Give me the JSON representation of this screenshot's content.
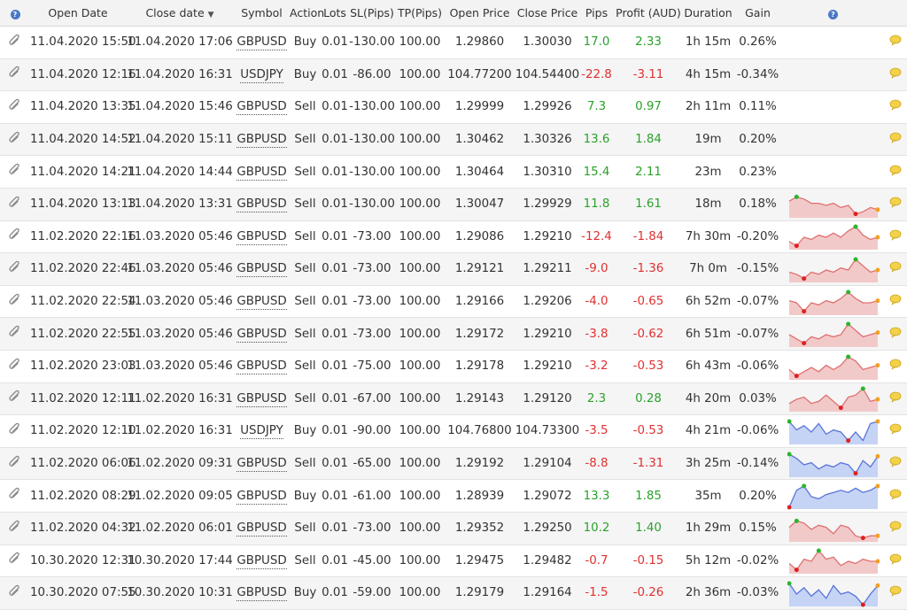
{
  "colors": {
    "positive": "#2aa12a",
    "negative": "#e03030",
    "spark_red_fill": "#f2c9c9",
    "spark_red_line": "#e07070",
    "spark_blue_fill": "#c5d4f5",
    "spark_blue_line": "#5a74d8"
  },
  "header": {
    "help_icon": "help-icon",
    "open_date": "Open Date",
    "close_date": "Close date",
    "symbol": "Symbol",
    "action": "Action",
    "lots": "Lots",
    "sl": "SL(Pips)",
    "tp": "TP(Pips)",
    "open_price": "Open Price",
    "close_price": "Close Price",
    "pips": "Pips",
    "profit": "Profit (AUD)",
    "duration": "Duration",
    "gain": "Gain"
  },
  "rows": [
    {
      "open_date": "11.04.2020 15:50",
      "close_date": "11.04.2020 17:06",
      "symbol": "GBPUSD",
      "action": "Buy",
      "lots": "0.01",
      "sl": "-130.00",
      "tp": "100.00",
      "open_price": "1.29860",
      "close_price": "1.30030",
      "pips": "17.0",
      "profit": "2.33",
      "duration": "1h 15m",
      "gain": "0.26%",
      "spark": null
    },
    {
      "open_date": "11.04.2020 12:16",
      "close_date": "11.04.2020 16:31",
      "symbol": "USDJPY",
      "action": "Buy",
      "lots": "0.01",
      "sl": "-86.00",
      "tp": "100.00",
      "open_price": "104.77200",
      "close_price": "104.54400",
      "pips": "-22.8",
      "profit": "-3.11",
      "duration": "4h 15m",
      "gain": "-0.34%",
      "spark": null
    },
    {
      "open_date": "11.04.2020 13:35",
      "close_date": "11.04.2020 15:46",
      "symbol": "GBPUSD",
      "action": "Sell",
      "lots": "0.01",
      "sl": "-130.00",
      "tp": "100.00",
      "open_price": "1.29999",
      "close_price": "1.29926",
      "pips": "7.3",
      "profit": "0.97",
      "duration": "2h 11m",
      "gain": "0.11%",
      "spark": null
    },
    {
      "open_date": "11.04.2020 14:52",
      "close_date": "11.04.2020 15:11",
      "symbol": "GBPUSD",
      "action": "Sell",
      "lots": "0.01",
      "sl": "-130.00",
      "tp": "100.00",
      "open_price": "1.30462",
      "close_price": "1.30326",
      "pips": "13.6",
      "profit": "1.84",
      "duration": "19m",
      "gain": "0.20%",
      "spark": null
    },
    {
      "open_date": "11.04.2020 14:21",
      "close_date": "11.04.2020 14:44",
      "symbol": "GBPUSD",
      "action": "Sell",
      "lots": "0.01",
      "sl": "-130.00",
      "tp": "100.00",
      "open_price": "1.30464",
      "close_price": "1.30310",
      "pips": "15.4",
      "profit": "2.11",
      "duration": "23m",
      "gain": "0.23%",
      "spark": null
    },
    {
      "open_date": "11.04.2020 13:13",
      "close_date": "11.04.2020 13:31",
      "symbol": "GBPUSD",
      "action": "Sell",
      "lots": "0.01",
      "sl": "-130.00",
      "tp": "100.00",
      "open_price": "1.30047",
      "close_price": "1.29929",
      "pips": "11.8",
      "profit": "1.61",
      "duration": "18m",
      "gain": "0.18%",
      "spark": {
        "color": "red",
        "values": [
          0.7,
          0.9,
          0.8,
          0.6,
          0.6,
          0.5,
          0.6,
          0.4,
          0.5,
          0.1,
          0.2,
          0.4,
          0.3
        ]
      }
    },
    {
      "open_date": "11.02.2020 22:16",
      "close_date": "11.03.2020 05:46",
      "symbol": "GBPUSD",
      "action": "Sell",
      "lots": "0.01",
      "sl": "-73.00",
      "tp": "100.00",
      "open_price": "1.29086",
      "close_price": "1.29210",
      "pips": "-12.4",
      "profit": "-1.84",
      "duration": "7h 30m",
      "gain": "-0.20%",
      "spark": {
        "color": "red",
        "values": [
          0.3,
          0.1,
          0.5,
          0.4,
          0.6,
          0.5,
          0.7,
          0.5,
          0.8,
          1.0,
          0.6,
          0.4,
          0.5
        ]
      }
    },
    {
      "open_date": "11.02.2020 22:46",
      "close_date": "11.03.2020 05:46",
      "symbol": "GBPUSD",
      "action": "Sell",
      "lots": "0.01",
      "sl": "-73.00",
      "tp": "100.00",
      "open_price": "1.29121",
      "close_price": "1.29211",
      "pips": "-9.0",
      "profit": "-1.36",
      "duration": "7h 0m",
      "gain": "-0.15%",
      "spark": {
        "color": "red",
        "values": [
          0.4,
          0.3,
          0.1,
          0.4,
          0.3,
          0.5,
          0.4,
          0.6,
          0.5,
          1.0,
          0.7,
          0.4,
          0.5
        ]
      }
    },
    {
      "open_date": "11.02.2020 22:54",
      "close_date": "11.03.2020 05:46",
      "symbol": "GBPUSD",
      "action": "Sell",
      "lots": "0.01",
      "sl": "-73.00",
      "tp": "100.00",
      "open_price": "1.29166",
      "close_price": "1.29206",
      "pips": "-4.0",
      "profit": "-0.65",
      "duration": "6h 52m",
      "gain": "-0.07%",
      "spark": {
        "color": "red",
        "values": [
          0.6,
          0.5,
          0.1,
          0.5,
          0.4,
          0.6,
          0.5,
          0.7,
          1.0,
          0.7,
          0.5,
          0.5,
          0.6
        ]
      }
    },
    {
      "open_date": "11.02.2020 22:55",
      "close_date": "11.03.2020 05:46",
      "symbol": "GBPUSD",
      "action": "Sell",
      "lots": "0.01",
      "sl": "-73.00",
      "tp": "100.00",
      "open_price": "1.29172",
      "close_price": "1.29210",
      "pips": "-3.8",
      "profit": "-0.62",
      "duration": "6h 51m",
      "gain": "-0.07%",
      "spark": {
        "color": "red",
        "values": [
          0.5,
          0.3,
          0.1,
          0.4,
          0.3,
          0.5,
          0.4,
          0.5,
          1.0,
          0.7,
          0.4,
          0.5,
          0.6
        ]
      }
    },
    {
      "open_date": "11.02.2020 23:03",
      "close_date": "11.03.2020 05:46",
      "symbol": "GBPUSD",
      "action": "Sell",
      "lots": "0.01",
      "sl": "-75.00",
      "tp": "100.00",
      "open_price": "1.29178",
      "close_price": "1.29210",
      "pips": "-3.2",
      "profit": "-0.53",
      "duration": "6h 43m",
      "gain": "-0.06%",
      "spark": {
        "color": "red",
        "values": [
          0.4,
          0.1,
          0.3,
          0.5,
          0.3,
          0.6,
          0.4,
          0.6,
          1.0,
          0.8,
          0.4,
          0.5,
          0.6
        ]
      }
    },
    {
      "open_date": "11.02.2020 12:11",
      "close_date": "11.02.2020 16:31",
      "symbol": "GBPUSD",
      "action": "Sell",
      "lots": "0.01",
      "sl": "-67.00",
      "tp": "100.00",
      "open_price": "1.29143",
      "close_price": "1.29120",
      "pips": "2.3",
      "profit": "0.28",
      "duration": "4h 20m",
      "gain": "0.03%",
      "spark": {
        "color": "red",
        "values": [
          0.3,
          0.5,
          0.6,
          0.3,
          0.4,
          0.7,
          0.4,
          0.1,
          0.6,
          0.7,
          1.0,
          0.4,
          0.5
        ]
      }
    },
    {
      "open_date": "11.02.2020 12:10",
      "close_date": "11.02.2020 16:31",
      "symbol": "USDJPY",
      "action": "Buy",
      "lots": "0.01",
      "sl": "-90.00",
      "tp": "100.00",
      "open_price": "104.76800",
      "close_price": "104.73300",
      "pips": "-3.5",
      "profit": "-0.53",
      "duration": "4h 21m",
      "gain": "-0.06%",
      "spark": {
        "color": "blue",
        "values": [
          1.0,
          0.6,
          0.8,
          0.5,
          0.9,
          0.4,
          0.6,
          0.5,
          0.1,
          0.5,
          0.1,
          0.9,
          1.0
        ]
      }
    },
    {
      "open_date": "11.02.2020 06:06",
      "close_date": "11.02.2020 09:31",
      "symbol": "GBPUSD",
      "action": "Sell",
      "lots": "0.01",
      "sl": "-65.00",
      "tp": "100.00",
      "open_price": "1.29192",
      "close_price": "1.29104",
      "pips": "-8.8",
      "profit": "-1.31",
      "duration": "3h 25m",
      "gain": "-0.14%",
      "spark": {
        "color": "blue",
        "values": [
          1.0,
          0.8,
          0.5,
          0.6,
          0.3,
          0.5,
          0.4,
          0.6,
          0.5,
          0.1,
          0.7,
          0.4,
          0.9
        ]
      }
    },
    {
      "open_date": "11.02.2020 08:29",
      "close_date": "11.02.2020 09:05",
      "symbol": "GBPUSD",
      "action": "Buy",
      "lots": "0.01",
      "sl": "-61.00",
      "tp": "100.00",
      "open_price": "1.28939",
      "close_price": "1.29072",
      "pips": "13.3",
      "profit": "1.85",
      "duration": "35m",
      "gain": "0.20%",
      "spark": {
        "color": "blue",
        "values": [
          0.0,
          0.8,
          1.0,
          0.5,
          0.4,
          0.6,
          0.7,
          0.8,
          0.7,
          0.9,
          0.7,
          0.8,
          1.0
        ]
      }
    },
    {
      "open_date": "11.02.2020 04:32",
      "close_date": "11.02.2020 06:01",
      "symbol": "GBPUSD",
      "action": "Sell",
      "lots": "0.01",
      "sl": "-73.00",
      "tp": "100.00",
      "open_price": "1.29352",
      "close_price": "1.29250",
      "pips": "10.2",
      "profit": "1.40",
      "duration": "1h 29m",
      "gain": "0.15%",
      "spark": {
        "color": "red",
        "values": [
          0.6,
          0.9,
          0.8,
          0.5,
          0.7,
          0.6,
          0.3,
          0.7,
          0.6,
          0.2,
          0.1,
          0.2,
          0.2
        ]
      }
    },
    {
      "open_date": "10.30.2020 12:31",
      "close_date": "10.30.2020 17:44",
      "symbol": "GBPUSD",
      "action": "Sell",
      "lots": "0.01",
      "sl": "-45.00",
      "tp": "100.00",
      "open_price": "1.29475",
      "close_price": "1.29482",
      "pips": "-0.7",
      "profit": "-0.15",
      "duration": "5h 12m",
      "gain": "-0.02%",
      "spark": {
        "color": "red",
        "values": [
          0.4,
          0.1,
          0.6,
          0.5,
          1.0,
          0.6,
          0.7,
          0.3,
          0.5,
          0.4,
          0.6,
          0.5,
          0.5
        ]
      }
    },
    {
      "open_date": "10.30.2020 07:55",
      "close_date": "10.30.2020 10:31",
      "symbol": "GBPUSD",
      "action": "Buy",
      "lots": "0.01",
      "sl": "-59.00",
      "tp": "100.00",
      "open_price": "1.29179",
      "close_price": "1.29164",
      "pips": "-1.5",
      "profit": "-0.26",
      "duration": "2h 36m",
      "gain": "-0.03%",
      "spark": {
        "color": "blue",
        "values": [
          1.0,
          0.5,
          0.8,
          0.4,
          0.7,
          0.3,
          0.9,
          0.5,
          0.6,
          0.4,
          0.0,
          0.5,
          0.9
        ]
      }
    }
  ]
}
